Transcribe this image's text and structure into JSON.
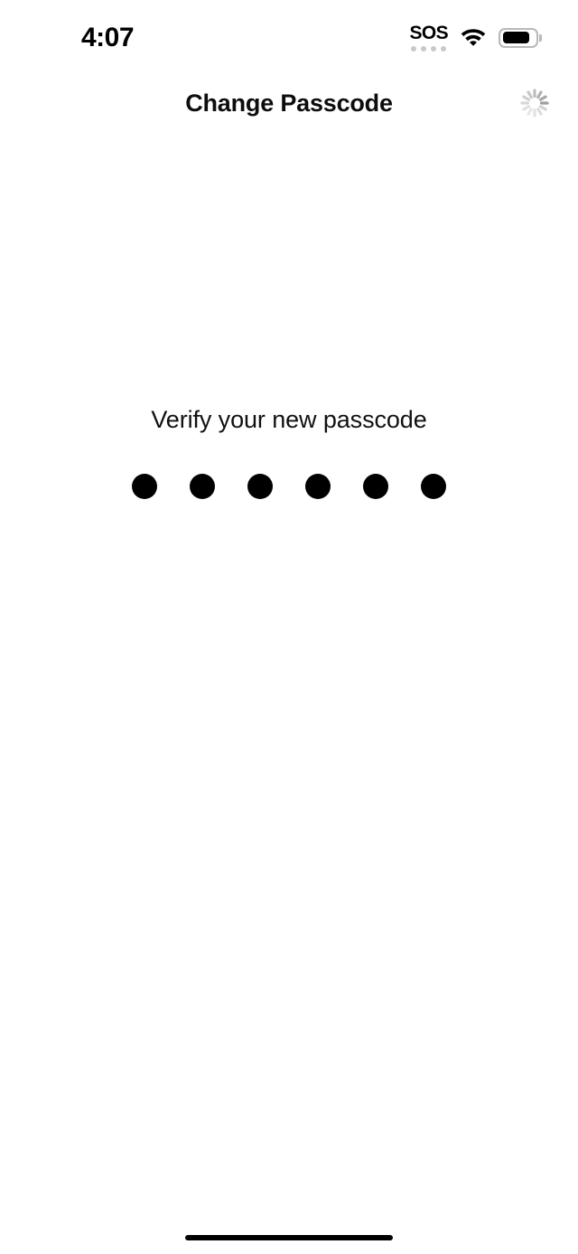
{
  "status_bar": {
    "time": "4:07",
    "cellular_label": "SOS",
    "cellular_dot_count": 4,
    "wifi_icon": "wifi-icon",
    "battery_level_percent": 85,
    "battery_icon": "battery-icon",
    "dot_color": "#c9c9c9",
    "text_color": "#000000"
  },
  "nav": {
    "title": "Change Passcode",
    "spinner_icon": "loading-spinner-icon",
    "spinner_color": "#d4d4d4"
  },
  "main": {
    "prompt": "Verify your new passcode",
    "passcode_length": 6,
    "passcode_filled_count": 6,
    "dot_color": "#000000"
  },
  "home_indicator": {
    "color": "#000000"
  }
}
